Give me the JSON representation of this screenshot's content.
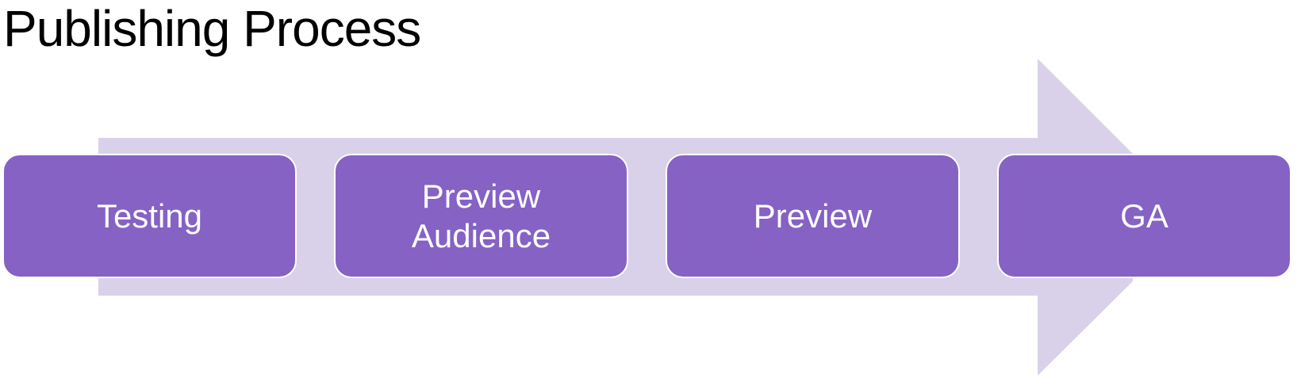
{
  "title": "Publishing Process",
  "colors": {
    "arrow_fill": "#d9d1e9",
    "step_fill": "#8562c4",
    "step_border": "#ffffff",
    "step_text": "#ffffff"
  },
  "steps": [
    {
      "label": "Testing"
    },
    {
      "label": "Preview\nAudience"
    },
    {
      "label": "Preview"
    },
    {
      "label": "GA"
    }
  ]
}
